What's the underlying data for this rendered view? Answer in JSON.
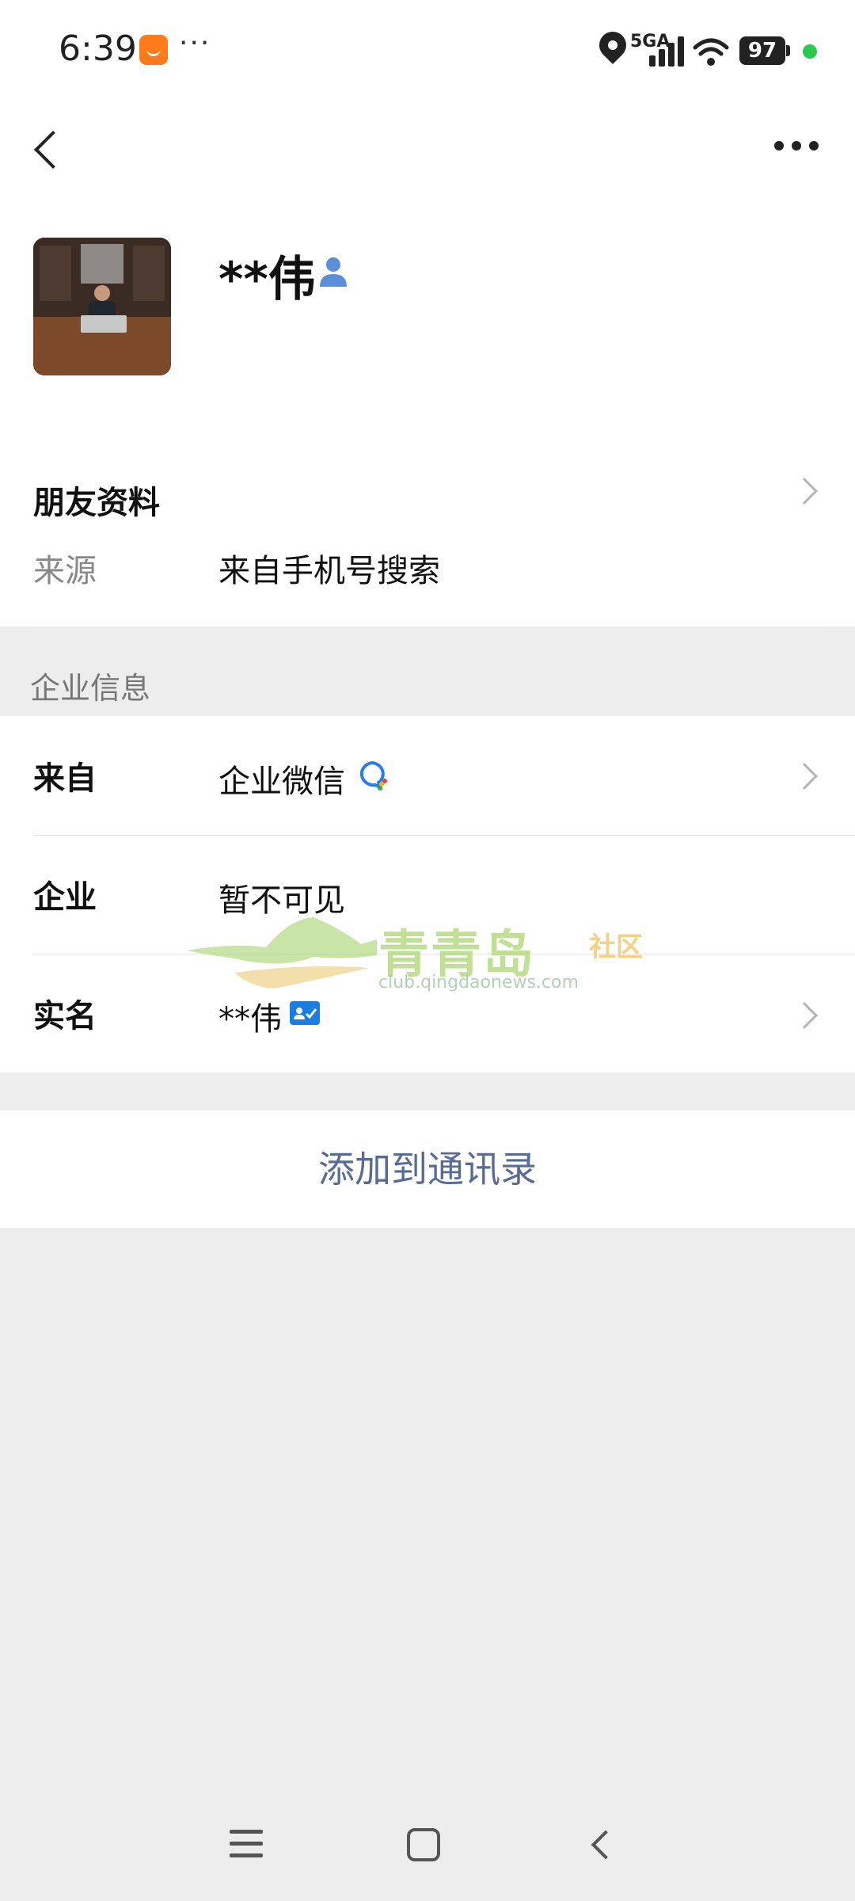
{
  "status_bar": {
    "time": "6:39",
    "network": "5GA",
    "battery": "97",
    "icons": [
      "app-notification-icon",
      "more-dots-icon",
      "location-icon",
      "signal-icon",
      "wifi-icon",
      "battery-icon",
      "green-dot-indicator"
    ]
  },
  "header": {
    "back_icon": "chevron-left-icon",
    "more_icon": "more-horizontal-icon"
  },
  "profile": {
    "name": "**伟",
    "badge_icon": "person-icon"
  },
  "friend_info": {
    "title": "朋友资料",
    "source_label": "来源",
    "source_value": "来自手机号搜索"
  },
  "company_section": {
    "title": "企业信息",
    "rows": [
      {
        "label": "来自",
        "value": "企业微信",
        "icon": "wework-icon"
      },
      {
        "label": "企业",
        "value": "暂不可见"
      },
      {
        "label": "实名",
        "value": "**伟",
        "icon": "verified-id-icon"
      }
    ]
  },
  "action": {
    "add_to_contacts": "添加到通讯录"
  },
  "watermark": {
    "name": "青青岛",
    "suffix": "社区",
    "url": "club.qingdaonews.com"
  },
  "nav_bar": {
    "icons": [
      "menu-icon",
      "home-icon",
      "back-icon"
    ]
  },
  "colors": {
    "background": "#ededed",
    "link_blue": "#576b95",
    "verify_blue": "#1a7de0",
    "status_green": "#2dc84d"
  }
}
